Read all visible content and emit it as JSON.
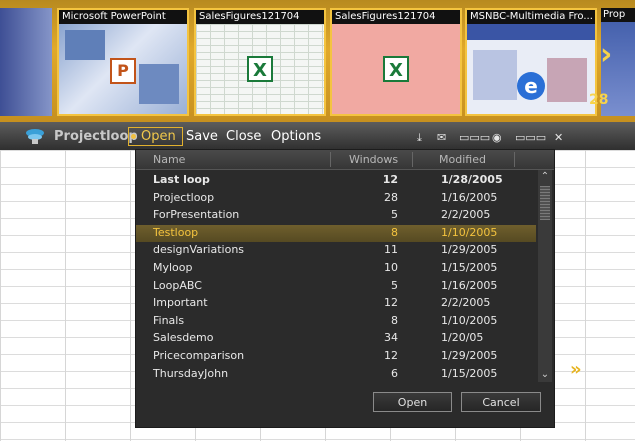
{
  "thumbnails": [
    {
      "title": "Microsoft PowerPoint",
      "app": "powerpoint"
    },
    {
      "title": "SalesFigures121704",
      "app": "excel"
    },
    {
      "title": "SalesFigures121704",
      "app": "excel"
    },
    {
      "title": "MSNBC-Multimedia Fro...",
      "app": "browser"
    }
  ],
  "partial_thumb_title": "Prop",
  "window_count": "28",
  "toolbar": {
    "brand": "Projectloop",
    "open_label": "Open",
    "save_label": "Save",
    "close_label": "Close",
    "options_label": "Options"
  },
  "dialog": {
    "columns": [
      "Name",
      "Windows",
      "Modified"
    ],
    "rows": [
      {
        "name": "Last loop",
        "windows": "12",
        "modified": "1/28/2005",
        "bold": true
      },
      {
        "name": "Projectloop",
        "windows": "28",
        "modified": "1/16/2005"
      },
      {
        "name": "ForPresentation",
        "windows": "5",
        "modified": "2/2/2005"
      },
      {
        "name": "Testloop",
        "windows": "8",
        "modified": "1/10/2005",
        "selected": true
      },
      {
        "name": "designVariations",
        "windows": "11",
        "modified": "1/29/2005"
      },
      {
        "name": "Myloop",
        "windows": "10",
        "modified": "1/15/2005"
      },
      {
        "name": "LoopABC",
        "windows": "5",
        "modified": "1/16/2005"
      },
      {
        "name": "Important",
        "windows": "12",
        "modified": "2/2/2005"
      },
      {
        "name": "Finals",
        "windows": "8",
        "modified": "1/10/2005"
      },
      {
        "name": "Salesdemo",
        "windows": "34",
        "modified": "1/20/05"
      },
      {
        "name": "Pricecomparison",
        "windows": "12",
        "modified": "1/29/2005"
      },
      {
        "name": "ThursdayJohn",
        "windows": "6",
        "modified": "1/15/2005"
      }
    ],
    "open_button": "Open",
    "cancel_button": "Cancel"
  },
  "colors": {
    "accent": "#f1c84b",
    "selection": "#6f5f2d",
    "dialog_bg": "#2b2b2b"
  }
}
